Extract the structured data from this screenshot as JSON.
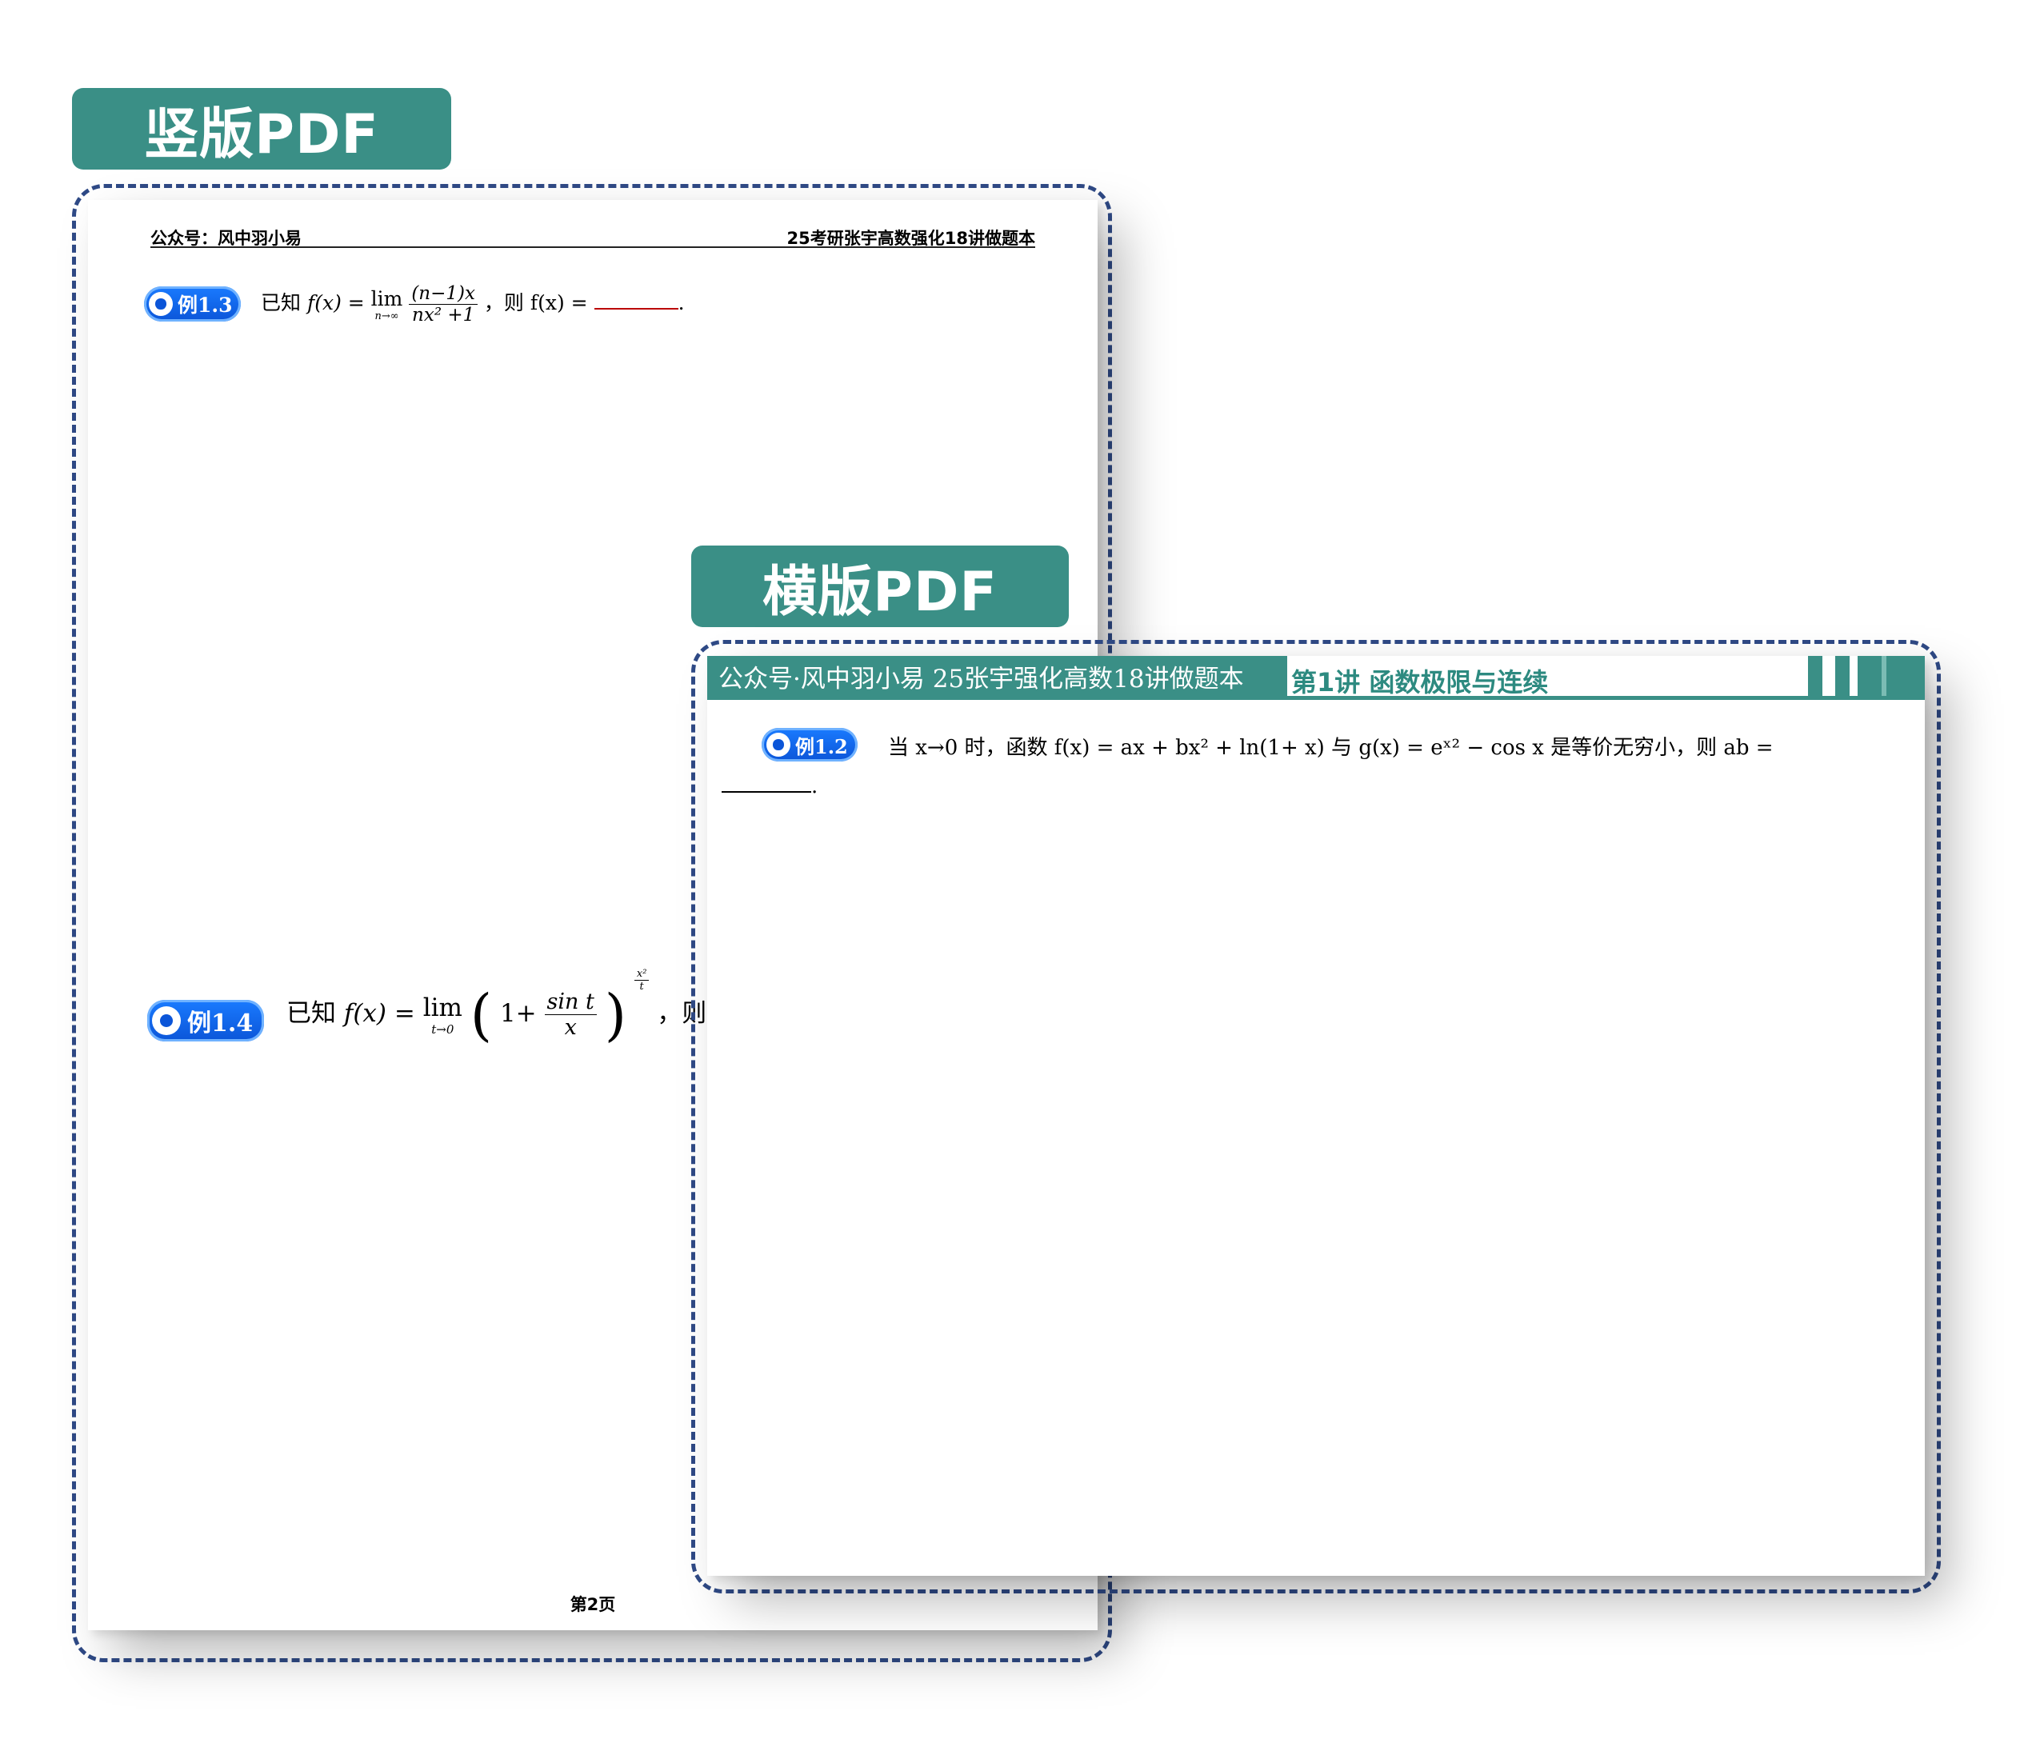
{
  "labels": {
    "portrait": "竖版PDF",
    "landscape": "横版PDF"
  },
  "portrait_page": {
    "header_left": "公众号：风中羽小易",
    "header_right": "25考研张宇高数强化18讲做题本",
    "examples": [
      {
        "badge": "例1.3",
        "prefix": "已知",
        "fx": "f(x) = ",
        "lim": "lim",
        "lim_sub": "n→∞",
        "num": "(n−1)x",
        "den": "nx² +1",
        "suffix": "，则 f(x) = "
      },
      {
        "badge": "例1.4",
        "prefix": "已知",
        "fx": "f(x) = ",
        "lim": "lim",
        "lim_sub": "t→0",
        "inner_lead": "1+",
        "num": "sin t",
        "den": "x",
        "exp_num": "x²",
        "exp_den": "t",
        "suffix": "，则 f(x) ="
      }
    ],
    "page_number": "第2页"
  },
  "landscape_page": {
    "header_left": "公众号·风中羽小易 25张宇强化高数18讲做题本",
    "header_right": "第1讲 函数极限与连续",
    "example": {
      "badge": "例1.2",
      "text": "当 x→0 时，函数 f(x) = ax + bx² + ln(1+ x) 与 g(x) = eˣ² − cos x 是等价无穷小，则 ab ="
    }
  },
  "colors": {
    "teal": "#3a8f86",
    "dashed_frame": "#2f4a86",
    "badge_blue": "#0b55d8"
  }
}
